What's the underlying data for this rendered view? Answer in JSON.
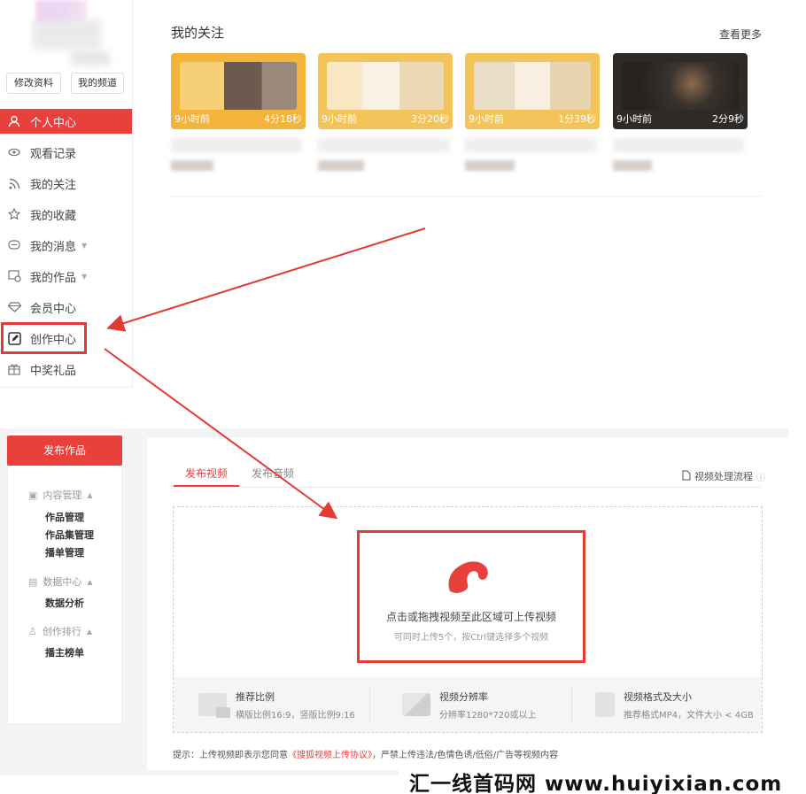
{
  "profile": {
    "edit_profile_button": "修改资料",
    "my_channel_button": "我的频道"
  },
  "sidebar": {
    "items": [
      {
        "label": "个人中心",
        "icon": "user-icon",
        "active": true
      },
      {
        "label": "观看记录",
        "icon": "eye-icon"
      },
      {
        "label": "我的关注",
        "icon": "rss-icon"
      },
      {
        "label": "我的收藏",
        "icon": "star-icon"
      },
      {
        "label": "我的消息",
        "icon": "message-icon",
        "has_chevron": true
      },
      {
        "label": "我的作品",
        "icon": "works-icon",
        "has_chevron": true
      },
      {
        "label": "会员中心",
        "icon": "diamond-icon"
      },
      {
        "label": "创作中心",
        "icon": "edit-icon",
        "highlighted": true
      },
      {
        "label": "中奖礼品",
        "icon": "gift-icon"
      }
    ]
  },
  "follow_section": {
    "title": "我的关注",
    "view_more": "查看更多",
    "cards": [
      {
        "age": "9小时前",
        "duration": "4分18秒"
      },
      {
        "age": "9小时前",
        "duration": "3分20秒"
      },
      {
        "age": "9小时前",
        "duration": "1分39秒"
      },
      {
        "age": "9小时前",
        "duration": "2分9秒"
      }
    ]
  },
  "creator": {
    "publish_button": "发布作品",
    "groups": [
      {
        "title": "内容管理",
        "icon": "content-icon",
        "items": [
          "作品管理",
          "作品集管理",
          "播单管理"
        ]
      },
      {
        "title": "数据中心",
        "icon": "data-icon",
        "items": [
          "数据分析"
        ]
      },
      {
        "title": "创作排行",
        "icon": "rank-icon",
        "items": [
          "播主榜单"
        ]
      }
    ],
    "tabs": [
      {
        "label": "发布视频",
        "active": true
      },
      {
        "label": "发布音频",
        "active": false
      }
    ],
    "process_link": "视频处理流程",
    "upload": {
      "main_text": "点击或拖拽视频至此区域可上传视频",
      "hint_text": "可同时上传5个，按Ctrl键选择多个视频"
    },
    "info": [
      {
        "title": "推荐比例",
        "desc": "横版比例16:9，竖版比例9:16"
      },
      {
        "title": "视频分辨率",
        "desc": "分辨率1280*720或以上"
      },
      {
        "title": "视频格式及大小",
        "desc": "推荐格式MP4，文件大小 < 4GB"
      }
    ],
    "tip_prefix": "提示：上传视频即表示您同意",
    "tip_link": "《搜狐视频上传协议》",
    "tip_suffix": "，严禁上传违法/色情色诱/低俗/广告等视频内容"
  },
  "watermark": "汇一线首码网 www.huiyixian.com",
  "colors": {
    "accent": "#e8403b",
    "annotation": "#e53935"
  }
}
